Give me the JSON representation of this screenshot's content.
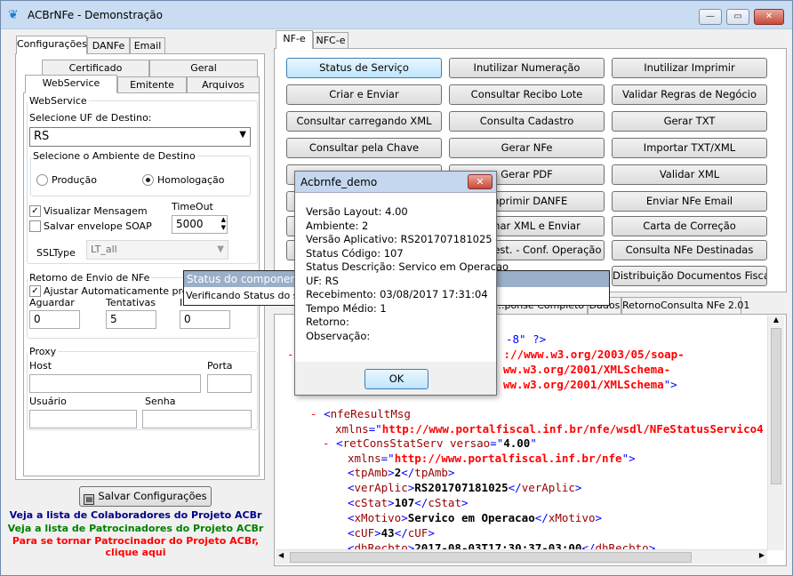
{
  "window": {
    "title": "ACBrNFe - Demonstração",
    "minimize": "—",
    "maximize": "▭",
    "close": "✕"
  },
  "left": {
    "tabs": [
      "Configurações",
      "DANFe",
      "Email"
    ],
    "subtabs_row1": [
      "Certificado",
      "Geral"
    ],
    "subtabs_row2": [
      "WebService",
      "Emitente",
      "Arquivos"
    ],
    "webservice": {
      "legend": "WebService",
      "uf_label": "Selecione UF de Destino:",
      "uf_value": "RS",
      "ambiente_legend": "Selecione o Ambiente de Destino",
      "producao": "Produção",
      "homologacao": "Homologação",
      "visualizar": "Visualizar Mensagem",
      "salvar_envelope": "Salvar envelope SOAP",
      "timeout_label": "TimeOut",
      "timeout_value": "5000",
      "ssltype_label": "SSLType",
      "ssltype_value": "LT_all"
    },
    "retorno": {
      "legend": "Retorno de Envio de NFe",
      "ajustar": "Ajustar Automaticamente prop. \"A",
      "aguardar_label": "Aguardar",
      "aguardar_value": "0",
      "tentativas_label": "Tentativas",
      "tentativas_value": "5",
      "intervalo_label": "In",
      "intervalo_value": "0"
    },
    "proxy": {
      "legend": "Proxy",
      "host": "Host",
      "porta": "Porta",
      "usuario": "Usuário",
      "senha": "Senha"
    },
    "salvar_button": "Salvar Configurações",
    "link1": "Veja a lista de Colaboradores do Projeto ACBr",
    "link2": "Veja a lista de Patrocinadores do Projeto ACBr",
    "link3a": "Para se tornar Patrocinador do Projeto ACBr,",
    "link3b": "clique aqui",
    "colors": {
      "link1": "#00008b",
      "link2": "#008000",
      "link3": "#ff0000"
    }
  },
  "right": {
    "tabs": [
      "NF-e",
      "NFC-e"
    ],
    "buttons": [
      [
        "Status de Serviço",
        "Inutilizar Numeração",
        "Inutilizar Imprimir"
      ],
      [
        "Criar e Enviar",
        "Consultar Recibo Lote",
        "Validar Regras de Negócio"
      ],
      [
        "Consultar carregando XML",
        "Consulta Cadastro",
        "Gerar TXT"
      ],
      [
        "Consultar pela Chave",
        "Gerar NFe",
        "Importar TXT/XML"
      ],
      [
        "",
        "Gerar PDF",
        "Validar XML"
      ],
      [
        "",
        "Imprimir DANFE",
        "Enviar NFe Email"
      ],
      [
        "",
        "Assinar XML e Enviar",
        "Carta de Correção"
      ],
      [
        "",
        "Manif. Dest. - Conf. Operação",
        "Consulta NFe Destinadas"
      ],
      [
        "",
        "",
        "Distribuição Documentos Fiscais"
      ]
    ],
    "bottom_tabs": [
      "...ponse Completo WS",
      "Dados",
      "RetornoConsulta NFe 2.01"
    ],
    "xml": {
      "l1": "-8\" ?>",
      "l2": "://www.w3.org/2003/05/soap-",
      "l3": "ww.w3.org/2001/XMLSchema-",
      "l4": "ww.w3.org/2001/XMLSchema",
      "l5_tag": "nfeResultMsg",
      "l6_attr": "xmlns",
      "l6_val": "http://www.portalfiscal.inf.br/nfe/wsdl/NFeStatusServico4",
      "l7_tag": "retConsStatServ",
      "l7_attr": "versao",
      "l7_val": "4.00",
      "l8_attr": "xmlns",
      "l8_val": "http://www.portalfiscal.inf.br/nfe",
      "rows": [
        {
          "tag": "tpAmb",
          "val": "2"
        },
        {
          "tag": "verAplic",
          "val": "RS201707181025"
        },
        {
          "tag": "cStat",
          "val": "107"
        },
        {
          "tag": "xMotivo",
          "val": "Servico em Operacao"
        },
        {
          "tag": "cUF",
          "val": "43"
        },
        {
          "tag": "dhRecbto",
          "val": "2017-08-03T17:30:37-03:00"
        }
      ]
    }
  },
  "status_popup": {
    "title": "Status do component",
    "message": "Verificando Status do serv"
  },
  "dialog": {
    "title": "Acbrnfe_demo",
    "lines": [
      "Versão Layout: 4.00",
      "Ambiente: 2",
      "Versão Aplicativo: RS201707181025",
      "Status Código: 107",
      "Status Descrição: Servico em Operacao",
      "UF: RS",
      "Recebimento: 03/08/2017 17:31:04",
      "Tempo Médio: 1",
      "Retorno:",
      "Observação:"
    ],
    "ok": "OK"
  }
}
